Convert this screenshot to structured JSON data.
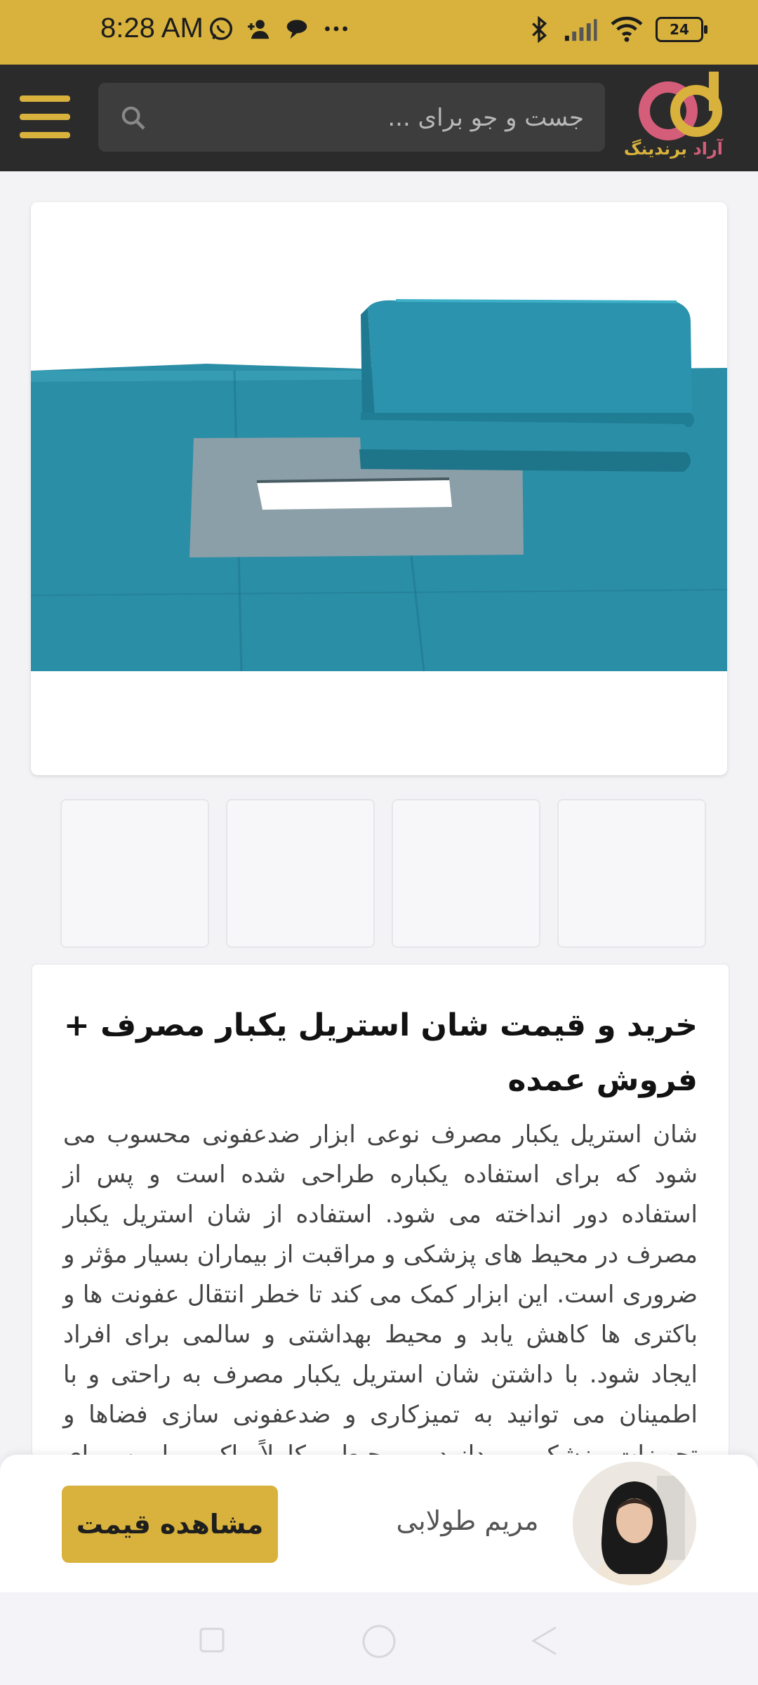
{
  "status_bar": {
    "time": "8:28 AM",
    "battery": "24",
    "left_icons": [
      "whatsapp-icon",
      "person-add-icon",
      "chat-bubble-icon",
      "more-dots-icon"
    ],
    "right_icons": [
      "bluetooth-icon",
      "signal-icon",
      "wifi-icon",
      "battery-icon"
    ]
  },
  "header": {
    "search_placeholder": "جست و جو برای ...",
    "logo_text_part1": "آراد",
    "logo_text_part2": "برندینگ"
  },
  "product": {
    "thumbnails_count": 4,
    "title": "خرید و قیمت شان استریل یکبار مصرف + فروش عمده",
    "description": "شان استریل یکبار مصرف نوعی ابزار ضدعفونی محسوب می شود که برای استفاده یکباره طراحی شده است و پس از استفاده دور انداخته می شود. استفاده از شان استریل یکبار مصرف در محیط های پزشکی و مراقبت از بیماران بسیار مؤثر و ضروری است. این ابزار کمک می کند تا خطر انتقال عفونت ها و باکتری ها کاهش یابد و محیط بهداشتی و سالمی برای افراد ایجاد شود. با داشتن شان استریل یکبار مصرف به راحتی و با اطمینان می توانید به تمیزکاری و ضدعفونی سازی فضاها و تجهیزات پزشکی بپردازید و محیطی کاملاً پاک و ایمن برای بیماران فراهم کنید."
  },
  "bottom_bar": {
    "price_button": "مشاهده قیمت",
    "agent_name": "مریم طولابی"
  },
  "colors": {
    "accent": "#d8b23c",
    "header_bg": "#2b2b2b",
    "drape_teal": "#2a8ea6"
  }
}
